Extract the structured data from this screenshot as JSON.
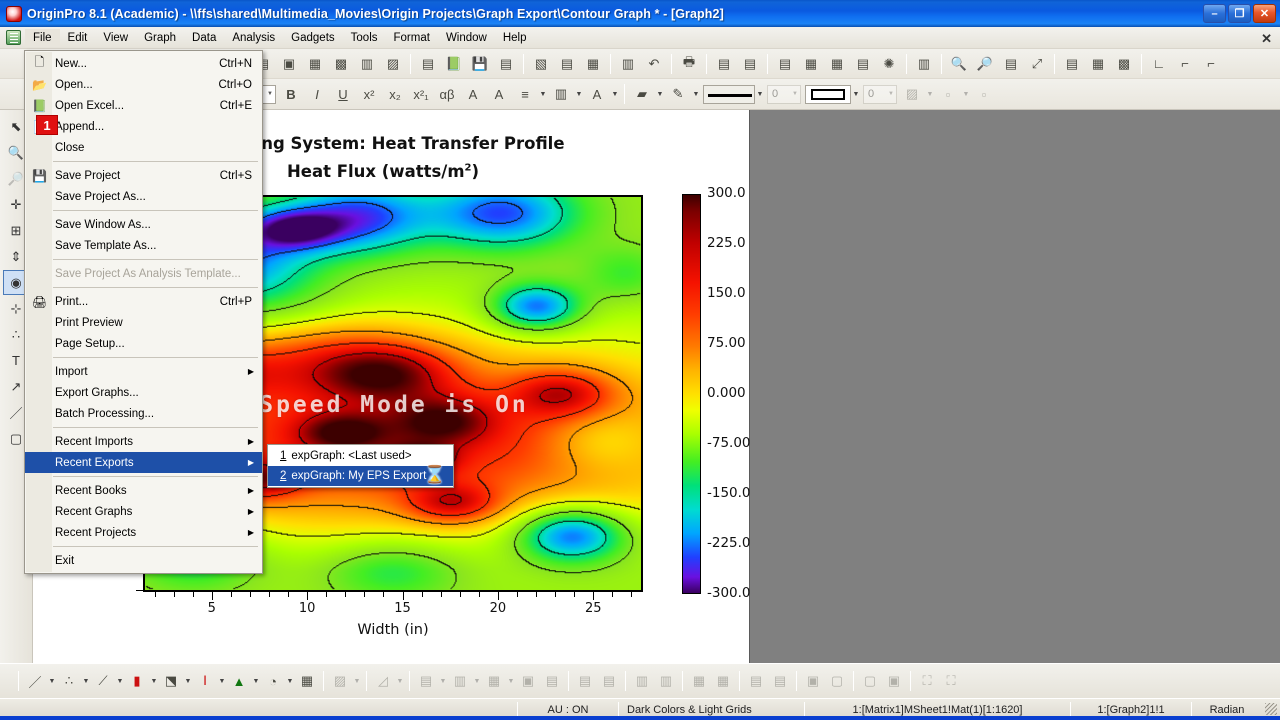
{
  "window": {
    "title": "OriginPro 8.1 (Academic) - \\\\ffs\\shared\\Multimedia_Movies\\Origin Projects\\Graph Export\\Contour Graph * - [Graph2]",
    "app_icon": "origin-logo-icon",
    "minimize_label": "–",
    "maximize_label": "❐",
    "close_label": "✕",
    "doc_close_label": "✕"
  },
  "menubar": {
    "items": [
      {
        "label": "File",
        "active": true
      },
      {
        "label": "Edit",
        "active": false
      },
      {
        "label": "View",
        "active": false
      },
      {
        "label": "Graph",
        "active": false
      },
      {
        "label": "Data",
        "active": false
      },
      {
        "label": "Analysis",
        "active": false
      },
      {
        "label": "Gadgets",
        "active": false
      },
      {
        "label": "Tools",
        "active": false
      },
      {
        "label": "Format",
        "active": false
      },
      {
        "label": "Window",
        "active": false
      },
      {
        "label": "Help",
        "active": false
      }
    ]
  },
  "file_menu": {
    "items": [
      {
        "type": "item",
        "label": "New...",
        "shortcut": "Ctrl+N",
        "icon": "new-document-icon",
        "underline": "N"
      },
      {
        "type": "item",
        "label": "Open...",
        "shortcut": "Ctrl+O",
        "icon": "open-folder-icon",
        "underline": "O"
      },
      {
        "type": "item",
        "label": "Open Excel...",
        "shortcut": "Ctrl+E",
        "icon": "open-excel-icon",
        "underline": "l"
      },
      {
        "type": "item",
        "label": "Append...",
        "shortcut": "",
        "icon": "append-icon",
        "underline": "d",
        "badge": "1"
      },
      {
        "type": "item",
        "label": "Close",
        "shortcut": "",
        "icon": "",
        "underline": "C"
      },
      {
        "type": "sep"
      },
      {
        "type": "item",
        "label": "Save Project",
        "shortcut": "Ctrl+S",
        "icon": "save-disk-icon",
        "underline": "S"
      },
      {
        "type": "item",
        "label": "Save Project As...",
        "shortcut": "",
        "icon": "",
        "underline": "A"
      },
      {
        "type": "sep"
      },
      {
        "type": "item",
        "label": "Save Window As...",
        "shortcut": "",
        "icon": "",
        "underline": "i"
      },
      {
        "type": "item",
        "label": "Save Template As...",
        "shortcut": "",
        "icon": "",
        "underline": "T"
      },
      {
        "type": "sep"
      },
      {
        "type": "item",
        "label": "Save Project As Analysis Template...",
        "shortcut": "",
        "icon": "",
        "disabled": true
      },
      {
        "type": "sep"
      },
      {
        "type": "item",
        "label": "Print...",
        "shortcut": "Ctrl+P",
        "icon": "printer-icon",
        "underline": "P"
      },
      {
        "type": "item",
        "label": "Print Preview",
        "shortcut": "",
        "icon": "",
        "underline": "v"
      },
      {
        "type": "item",
        "label": "Page Setup...",
        "shortcut": "",
        "icon": "",
        "underline": "u"
      },
      {
        "type": "sep"
      },
      {
        "type": "item",
        "label": "Import",
        "shortcut": "",
        "icon": "",
        "submenu": true,
        "underline": "m"
      },
      {
        "type": "item",
        "label": "Export Graphs...",
        "shortcut": "",
        "icon": "",
        "underline": "E"
      },
      {
        "type": "item",
        "label": "Batch Processing...",
        "shortcut": "",
        "icon": "",
        "underline": "h"
      },
      {
        "type": "sep"
      },
      {
        "type": "item",
        "label": "Recent Imports",
        "shortcut": "",
        "icon": "",
        "submenu": true,
        "underline": "R"
      },
      {
        "type": "item",
        "label": "Recent Exports",
        "shortcut": "",
        "icon": "",
        "submenu": true,
        "selected": true,
        "underline": "E"
      },
      {
        "type": "sep"
      },
      {
        "type": "item",
        "label": "Recent Books",
        "shortcut": "",
        "icon": "",
        "submenu": true,
        "underline": "B"
      },
      {
        "type": "item",
        "label": "Recent Graphs",
        "shortcut": "",
        "icon": "",
        "submenu": true,
        "underline": "G"
      },
      {
        "type": "item",
        "label": "Recent Projects",
        "shortcut": "",
        "icon": "",
        "submenu": true,
        "underline": "P"
      },
      {
        "type": "sep"
      },
      {
        "type": "item",
        "label": "Exit",
        "shortcut": "",
        "icon": "",
        "underline": "x"
      }
    ]
  },
  "recent_exports_submenu": {
    "items": [
      {
        "number": "1",
        "label": "expGraph: <Last used>",
        "selected": false
      },
      {
        "number": "2",
        "label": "expGraph: My EPS Export",
        "selected": true
      }
    ],
    "cursor": "hourglass-cursor"
  },
  "toolbar_top": {
    "buttons": [
      {
        "icon": "new-project-icon"
      },
      {
        "icon": "new-folder-icon"
      },
      {
        "icon": "new-workbook-icon"
      },
      {
        "icon": "new-graph-icon"
      },
      {
        "icon": "new-matrix-icon"
      },
      {
        "icon": "new-layout-icon"
      },
      {
        "sep": true
      },
      {
        "icon": "open-project-icon"
      },
      {
        "icon": "open-excel-icon"
      },
      {
        "icon": "save-project-icon"
      },
      {
        "icon": "save-window-icon"
      },
      {
        "sep": true
      },
      {
        "icon": "import-wizard-icon"
      },
      {
        "icon": "import-single-ascii-icon"
      },
      {
        "icon": "import-multiple-ascii-icon"
      },
      {
        "sep": true
      },
      {
        "icon": "copy-page-icon"
      },
      {
        "icon": "undo-icon"
      },
      {
        "sep": true
      },
      {
        "icon": "print-icon"
      },
      {
        "sep": true
      },
      {
        "icon": "edit-notes-icon"
      },
      {
        "icon": "layers-icon"
      },
      {
        "sep": true
      },
      {
        "icon": "project-explorer-icon"
      },
      {
        "icon": "results-log-icon"
      },
      {
        "icon": "workbook-icon"
      },
      {
        "icon": "script-window-icon"
      },
      {
        "icon": "code-builder-icon"
      },
      {
        "sep": true
      },
      {
        "icon": "slider-icon"
      },
      {
        "sep": true
      },
      {
        "icon": "zoom-in-icon"
      },
      {
        "icon": "zoom-out-icon"
      },
      {
        "icon": "legend-icon"
      },
      {
        "icon": "rescale-icon"
      },
      {
        "sep": true
      },
      {
        "icon": "merge-graph-icon"
      },
      {
        "icon": "extract-layers-icon"
      },
      {
        "icon": "extract-plots-icon"
      },
      {
        "sep": true
      },
      {
        "icon": "add-bottom-x-left-y-icon"
      },
      {
        "icon": "add-top-x-right-y-icon"
      },
      {
        "icon": "add-right-y-icon"
      }
    ]
  },
  "toolbar_format": {
    "font_name": "",
    "font_size": "",
    "buttons": [
      {
        "icon": "bold-icon",
        "label": "B"
      },
      {
        "icon": "italic-icon",
        "label": "I"
      },
      {
        "icon": "underline-icon",
        "label": "U"
      },
      {
        "icon": "superscript-icon",
        "label": "x²"
      },
      {
        "icon": "subscript-icon",
        "label": "x₂"
      },
      {
        "icon": "super-subscript-icon",
        "label": "x²₁"
      },
      {
        "icon": "greek-icon",
        "label": "αβ"
      },
      {
        "icon": "increase-font-icon",
        "label": "A"
      },
      {
        "icon": "decrease-font-icon",
        "label": "A"
      },
      {
        "icon": "align-icon"
      },
      {
        "icon": "line-spacing-icon"
      },
      {
        "icon": "font-color-icon",
        "label": "A"
      }
    ],
    "fill_color_label": "fill-color-icon",
    "line_color_label": "line-color-icon",
    "line_width_value": "0",
    "border_width_value": "0",
    "pattern_label": "pattern-fill-icon"
  },
  "left_tools": {
    "items": [
      {
        "icon": "pointer-icon",
        "selected": false
      },
      {
        "icon": "zoom-in-icon",
        "selected": false
      },
      {
        "icon": "zoom-out-icon",
        "selected": false,
        "disabled": true
      },
      {
        "icon": "data-reader-icon",
        "selected": false
      },
      {
        "icon": "screen-reader-icon",
        "selected": false
      },
      {
        "icon": "data-selector-icon",
        "selected": false
      },
      {
        "icon": "regional-mask-icon",
        "selected": true
      },
      {
        "icon": "regional-data-select-icon",
        "selected": false
      },
      {
        "icon": "scatter-icon",
        "selected": false
      },
      {
        "icon": "text-tool-icon",
        "selected": false
      },
      {
        "icon": "arrow-tool-icon",
        "selected": false
      },
      {
        "icon": "line-tool-icon",
        "selected": false
      },
      {
        "icon": "rectangle-tool-icon",
        "selected": false
      }
    ]
  },
  "graph": {
    "title": "Car Seat Warming System: Heat Transfer Profile",
    "title_visible": "Warming System: Heat Transfer Profile",
    "subtitle_prefix": "Heat Flux (watts/m",
    "subtitle_sup": "2",
    "subtitle_suffix": ")",
    "watermark": "Speed Mode is On",
    "x_axis_title": "Width (in)",
    "x_ticks": [
      "5",
      "10",
      "15",
      "20",
      "25"
    ],
    "colorbar_labels": [
      "300.0",
      "225.0",
      "150.0",
      "75.00",
      "0.000",
      "-75.00",
      "-150.0",
      "-225.0",
      "-300.0"
    ]
  },
  "chart_data": {
    "type": "heatmap",
    "title": "Car Seat Warming System: Heat Transfer Profile",
    "subtitle": "Heat Flux (watts/m2)",
    "xlabel": "Width (in)",
    "ylabel": "",
    "xticks": [
      5,
      10,
      15,
      20,
      25
    ],
    "xlim": [
      1.5,
      27.5
    ],
    "colorbar": {
      "label": "Heat Flux (watts/m2)",
      "ticks": [
        300.0,
        225.0,
        150.0,
        75.0,
        0.0,
        -75.0,
        -150.0,
        -225.0,
        -300.0
      ],
      "range": [
        -300.0,
        300.0
      ],
      "colormap": "rainbow-dark-red-to-violet"
    },
    "contour_levels": [
      -300,
      -225,
      -150,
      -75,
      0,
      75,
      150,
      225,
      300
    ],
    "matrix": "Mat(1)[1:1620]",
    "notes": "Smooth 2D contour field; warm (red/orange) band across the lower-middle region, cooler (green/cyan/blue) pockets along the top and lower-right."
  },
  "bottom_toolbar": {
    "buttons": [
      {
        "icon": "line-plot-icon",
        "arrow": true
      },
      {
        "icon": "scatter-plot-icon",
        "arrow": true
      },
      {
        "icon": "line-symbol-plot-icon",
        "arrow": true
      },
      {
        "icon": "column-bar-plot-icon",
        "arrow": true
      },
      {
        "icon": "area-plot-icon",
        "arrow": true
      },
      {
        "icon": "floating-bar-plot-icon",
        "arrow": true
      },
      {
        "icon": "fill-area-plot-icon",
        "arrow": true
      },
      {
        "icon": "pie-plot-icon",
        "arrow": true
      },
      {
        "icon": "multi-panel-icon",
        "arrow": false
      },
      {
        "sep": true
      },
      {
        "icon": "contour-plot-icon",
        "arrow": true,
        "disabled": true
      },
      {
        "sep": true
      },
      {
        "icon": "3d-surface-icon",
        "arrow": true,
        "disabled": true
      },
      {
        "sep": true
      },
      {
        "icon": "3d-bar-icon",
        "arrow": true,
        "disabled": true
      },
      {
        "icon": "3d-wire-icon",
        "arrow": true,
        "disabled": true
      },
      {
        "icon": "image-plot-icon",
        "arrow": true,
        "disabled": true
      },
      {
        "icon": "profile-icon",
        "arrow": false,
        "disabled": true
      },
      {
        "icon": "speed-mode-icon",
        "arrow": false,
        "disabled": true
      },
      {
        "sep": true
      },
      {
        "icon": "align-left-icon",
        "disabled": true
      },
      {
        "icon": "align-center-icon",
        "disabled": true
      },
      {
        "sep": true
      },
      {
        "icon": "align-top-icon",
        "disabled": true
      },
      {
        "icon": "align-bottom-icon",
        "disabled": true
      },
      {
        "sep": true
      },
      {
        "icon": "distribute-horizontal-icon",
        "disabled": true
      },
      {
        "icon": "distribute-vertical-icon",
        "disabled": true
      },
      {
        "sep": true
      },
      {
        "icon": "same-width-icon",
        "disabled": true
      },
      {
        "icon": "same-height-icon",
        "disabled": true
      },
      {
        "sep": true
      },
      {
        "icon": "bring-to-front-icon",
        "disabled": true
      },
      {
        "icon": "send-to-back-icon",
        "disabled": true
      },
      {
        "sep": true
      },
      {
        "icon": "group-icon",
        "disabled": true
      },
      {
        "icon": "ungroup-icon",
        "disabled": true
      },
      {
        "sep": true
      },
      {
        "icon": "fit-page-icon",
        "disabled": true
      },
      {
        "icon": "fit-layers-icon",
        "disabled": true
      }
    ]
  },
  "statusbar": {
    "auto_update": "AU : ON",
    "theme": "Dark Colors & Light Grids",
    "source": "1:[Matrix1]MSheet1!Mat(1)[1:1620]",
    "window_ref": "1:[Graph2]1!1",
    "angle_unit": "Radian"
  }
}
